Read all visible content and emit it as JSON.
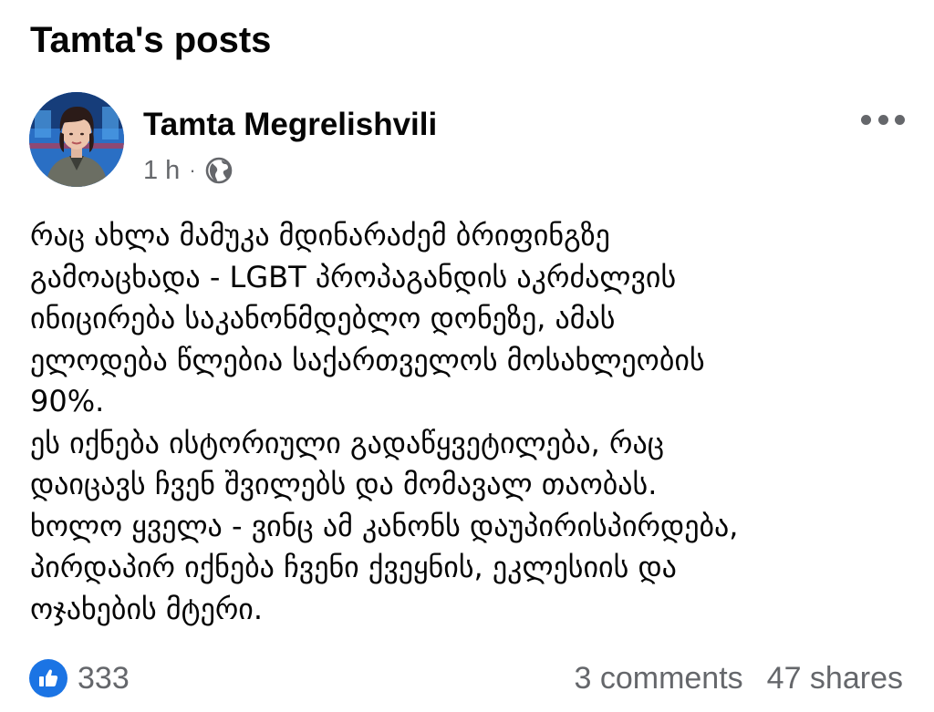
{
  "page": {
    "title": "Tamta's posts"
  },
  "post": {
    "author": "Tamta Megrelishvili",
    "time": "1 h",
    "separator": "·",
    "audience_icon": "globe-icon",
    "more_icon": "more-options-icon",
    "body_lines": [
      "რაც ახლა მამუკა მდინარაძემ ბრიფინგზე",
      "გამოაცხადა - LGBT პროპაგანდის აკრძალვის",
      "ინიცირება საკანონმდებლო დონეზე, ამას",
      "ელოდება წლებია საქართველოს მოსახლეობის",
      "90%.",
      "ეს იქნება ისტორიული გადაწყვეტილება, რაც",
      "დაიცავს ჩვენ შვილებს და მომავალ თაობას.",
      "ხოლო ყველა - ვინც ამ კანონს დაუპირისპირდება,",
      "პირდაპირ იქნება ჩვენი ქვეყნის, ეკლესიის და",
      "ოჯახების მტერი."
    ],
    "reactions": {
      "icon": "like-icon",
      "count": "333"
    },
    "comments": "3 comments",
    "shares": "47 shares"
  },
  "colors": {
    "text_primary": "#050505",
    "text_secondary": "#65676b",
    "like_blue": "#1b74e4",
    "background": "#ffffff"
  }
}
